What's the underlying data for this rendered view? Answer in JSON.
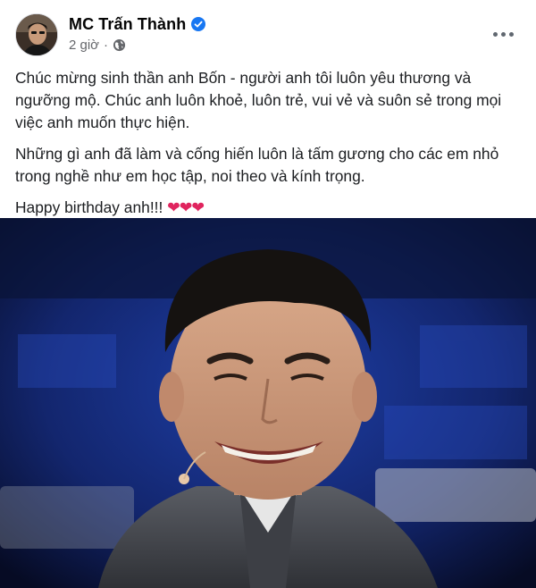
{
  "post": {
    "author": {
      "name": "MC Trấn Thành",
      "verified": true
    },
    "meta": {
      "time": "2 giờ",
      "separator": "·",
      "audience_icon": "globe-icon"
    },
    "more_icon": "more-horizontal-icon",
    "paragraphs": [
      "Chúc mừng sinh thần anh Bốn - người anh tôi luôn yêu thương và ngưỡng mộ. Chúc anh luôn khoẻ, luôn trẻ, vui vẻ và suôn sẻ trong mọi việc anh muốn thực hiện.",
      "Những gì anh đã làm và cống hiến luôn là tấm gương cho các em nhỏ trong nghề như em học tập, noi theo và kính trọng."
    ],
    "closing": {
      "text": "Happy birthday anh!!!",
      "hearts": "❤❤❤"
    },
    "photo": {
      "subject": "smiling man in grey suit on stage"
    }
  },
  "colors": {
    "verified_badge": "#1877f2",
    "secondary_text": "#65676b",
    "heart": "#e0245e",
    "photo_background": "#0f1a4a"
  }
}
